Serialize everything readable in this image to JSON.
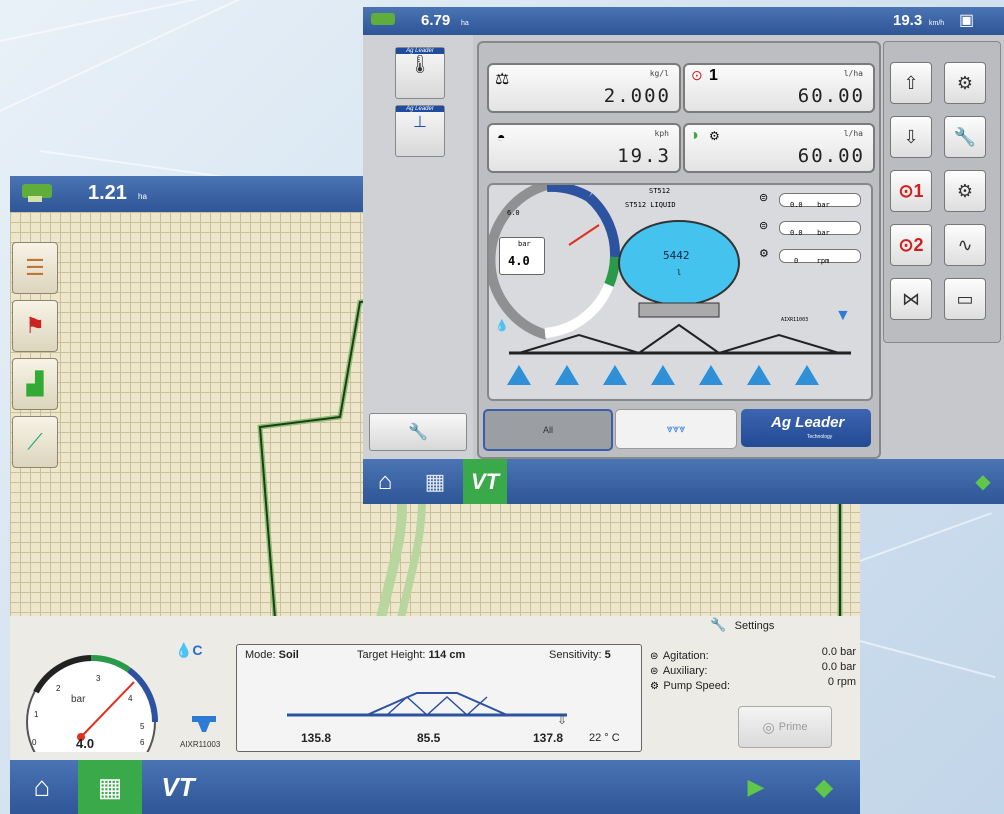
{
  "back": {
    "header": {
      "area_value": "1.21",
      "area_unit": "ha"
    },
    "side_tabs": [
      "legend-icon",
      "flag-icon",
      "chart-icon",
      "guidance-icon"
    ],
    "control": {
      "mode_label": "Mode:",
      "mode_value": "Soil",
      "target_label": "Target Height:",
      "target_value": "114 cm",
      "sensitivity_label": "Sensitivity:",
      "sensitivity_value": "5",
      "left_height": "135.8",
      "center_height": "85.5",
      "right_height": "137.8",
      "temperature": "22 ° C"
    },
    "settings_label": "Settings",
    "readings": [
      {
        "label": "Agitation:",
        "value": "0.0 bar"
      },
      {
        "label": "Auxiliary:",
        "value": "0.0 bar"
      },
      {
        "label": "Pump Speed:",
        "value": "0 rpm"
      }
    ],
    "prime_label": "Prime",
    "gauge": {
      "unit": "bar",
      "value": "4.0",
      "ticks": [
        "0",
        "1",
        "2",
        "3",
        "4",
        "5",
        "6"
      ]
    },
    "nozzle_label": "AIXR11003"
  },
  "front": {
    "header": {
      "area_value": "6.79",
      "area_unit": "ha",
      "speed_value": "19.3",
      "speed_unit": "km/h"
    },
    "panels": [
      {
        "unit": "kg/l",
        "value": "2.000"
      },
      {
        "unit": "l/ha",
        "value": "60.00",
        "badge": "1"
      },
      {
        "unit": "kph",
        "value": "19.3"
      },
      {
        "unit": "l/ha",
        "value": "60.00"
      }
    ],
    "tank": {
      "title1": "ST512",
      "title2": "ST512 LIQUID",
      "volume": "5442",
      "unit": "l"
    },
    "mini_gauge": {
      "unit": "bar",
      "value": "4.0",
      "tick_high": "6.0"
    },
    "readings": [
      {
        "value": "0.0",
        "unit": "bar"
      },
      {
        "value": "0.0",
        "unit": "bar"
      },
      {
        "value": "0",
        "unit": "rpm"
      }
    ],
    "nozzle_label": "AIXR11003",
    "tabs": {
      "all": "All",
      "brand": "Ag Leader",
      "brand_sub": "Technology"
    },
    "right_buttons": [
      "increase-rate-icon",
      "calibrate-icon",
      "decrease-rate-icon",
      "wrench-icon",
      "product-1-icon",
      "gear-icon",
      "product-2-icon",
      "diagnostics-icon",
      "valve-icon",
      "toolbox-icon"
    ],
    "left_tabs": [
      "Ag Leader",
      "Ag Leader"
    ]
  },
  "nav": {
    "vt_label": "VT"
  }
}
